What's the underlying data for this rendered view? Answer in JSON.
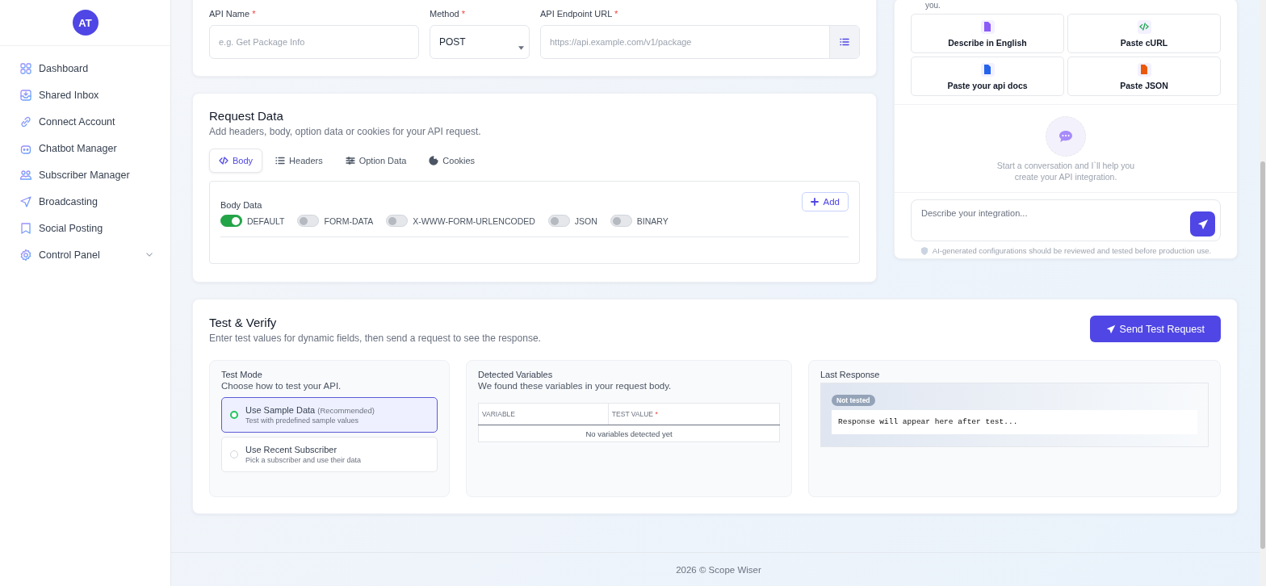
{
  "sidebar": {
    "avatar": "AT",
    "items": [
      {
        "label": "Dashboard",
        "expandable": false
      },
      {
        "label": "Shared Inbox",
        "expandable": false
      },
      {
        "label": "Connect Account",
        "expandable": false
      },
      {
        "label": "Chatbot Manager",
        "expandable": false
      },
      {
        "label": "Subscriber Manager",
        "expandable": false
      },
      {
        "label": "Broadcasting",
        "expandable": false
      },
      {
        "label": "Social Posting",
        "expandable": false
      },
      {
        "label": "Control Panel",
        "expandable": true
      }
    ]
  },
  "api_fields": {
    "name": {
      "label": "API Name",
      "required_mark": "*",
      "placeholder": "e.g. Get Package Info"
    },
    "method": {
      "label": "Method",
      "required_mark": "*",
      "value": "POST"
    },
    "endpoint": {
      "label": "API Endpoint URL",
      "required_mark": "*",
      "placeholder": "https://api.example.com/v1/package"
    }
  },
  "request_data": {
    "title": "Request Data",
    "subtitle": "Add headers, body, option data or cookies for your API request.",
    "tabs": [
      {
        "label": "Body",
        "selected": true
      },
      {
        "label": "Headers",
        "selected": false
      },
      {
        "label": "Option Data",
        "selected": false
      },
      {
        "label": "Cookies",
        "selected": false
      }
    ],
    "body_data": {
      "title": "Body Data",
      "add_label": "Add",
      "types": [
        {
          "label": "DEFAULT",
          "on": true
        },
        {
          "label": "FORM-DATA",
          "on": false
        },
        {
          "label": "X-WWW-FORM-URLENCODED",
          "on": false
        },
        {
          "label": "JSON",
          "on": false
        },
        {
          "label": "BINARY",
          "on": false
        }
      ]
    }
  },
  "ai_panel": {
    "intro_tail": "you.",
    "options": [
      {
        "label": "Describe in English",
        "color": "#8b5cf6"
      },
      {
        "label": "Paste cURL",
        "color": "#16a34a"
      },
      {
        "label": "Paste your api docs",
        "color": "#2563eb"
      },
      {
        "label": "Paste JSON",
        "color": "#ea580c"
      }
    ],
    "empty_text": "Start a conversation and I`ll help you create your API integration.",
    "input_placeholder": "Describe your integration...",
    "disclaimer": "AI-generated configurations should be reviewed and tested before production use."
  },
  "test": {
    "title": "Test & Verify",
    "subtitle": "Enter test values for dynamic fields, then send a request to see the response.",
    "send_label": "Send Test Request",
    "test_mode": {
      "title": "Test Mode",
      "subtitle": "Choose how to test your API.",
      "options": [
        {
          "label": "Use Sample Data",
          "note": "(Recommended)",
          "description": "Test with predefined sample values",
          "selected": true
        },
        {
          "label": "Use Recent Subscriber",
          "description": "Pick a subscriber and use their data",
          "selected": false
        }
      ]
    },
    "variables": {
      "title": "Detected Variables",
      "subtitle": "We found these variables in your request body.",
      "columns": [
        {
          "label": "VARIABLE"
        },
        {
          "label": "TEST VALUE",
          "required_mark": "*"
        }
      ],
      "empty": "No variables detected yet"
    },
    "last_response": {
      "title": "Last Response",
      "badge": "Not tested",
      "text": "Response will appear here after test..."
    }
  },
  "footer": "2026 © Scope Wiser"
}
